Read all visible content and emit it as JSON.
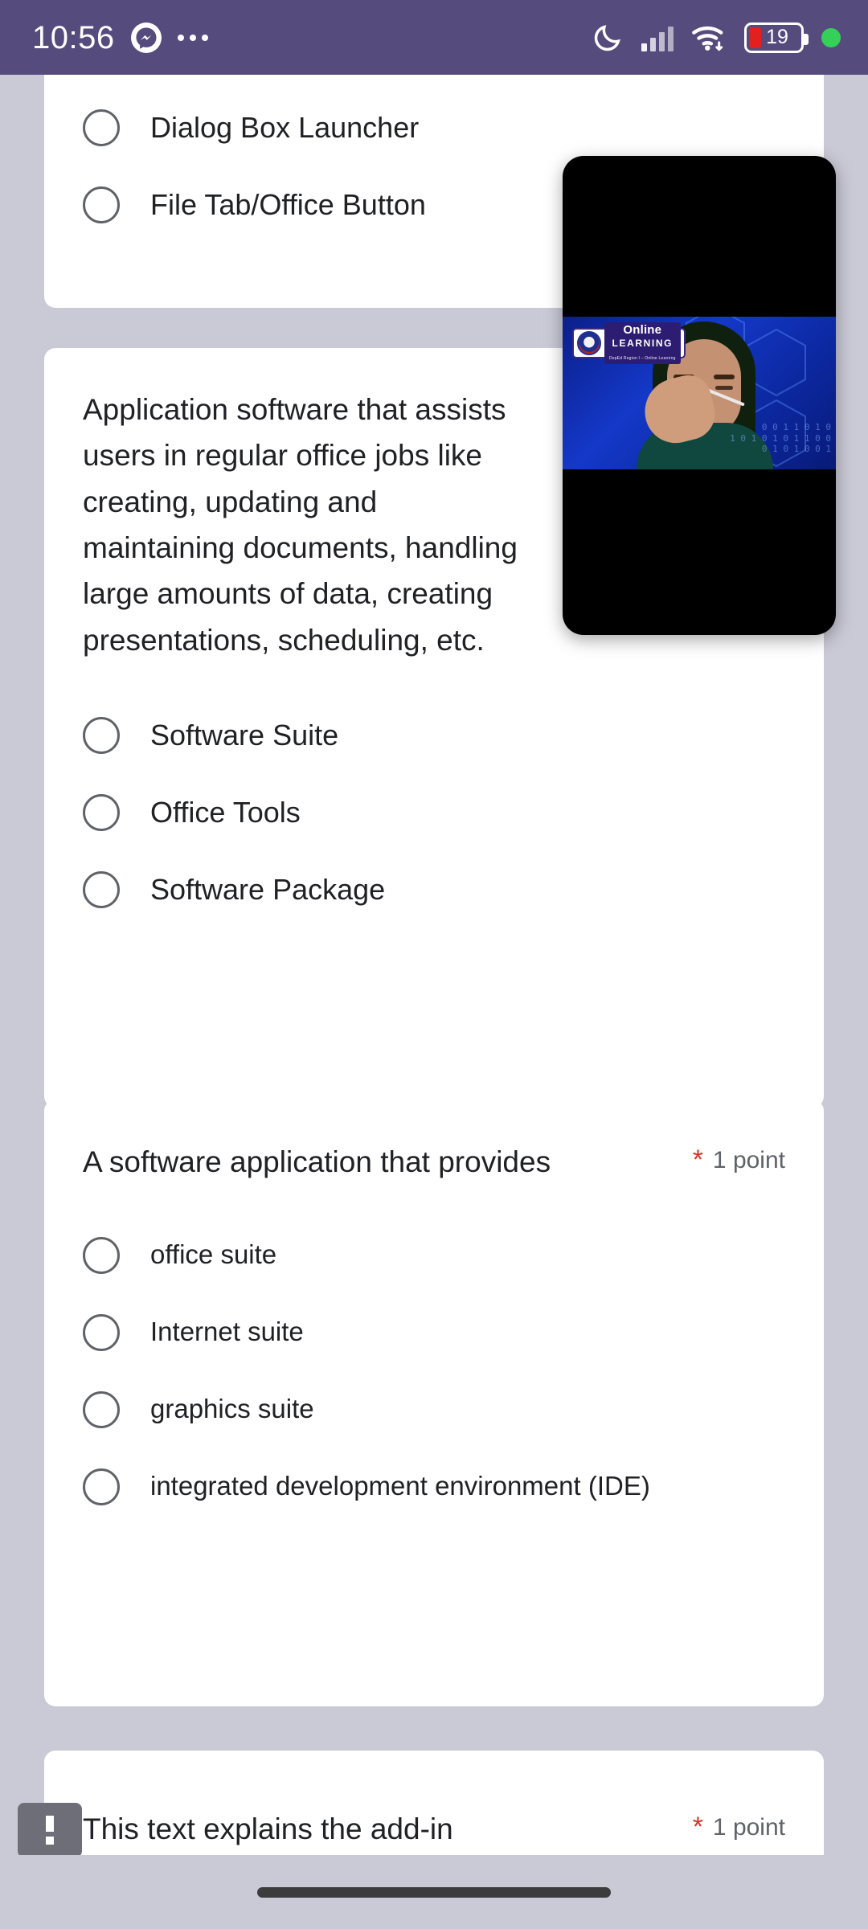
{
  "status_bar": {
    "time": "10:56",
    "messenger_icon": "messenger-icon",
    "overflow_icon": "more-notifications-icon",
    "dnd_icon": "moon-icon",
    "signal_icon": "cellular-signal-icon",
    "wifi_icon": "wifi-icon",
    "battery_level": "19",
    "battery_icon": "battery-icon",
    "recording_dot": "green-status-dot",
    "background_color": "#554c7d"
  },
  "theme": {
    "page_background": "#cac9d6",
    "card_background": "#ffffff",
    "text_primary": "#202124",
    "text_secondary": "#5f6368",
    "required_star_color": "#d93025",
    "battery_low_color": "#e32020",
    "status_dot_color": "#34d058"
  },
  "form": {
    "cards": [
      {
        "id": "question-dialog-box-launcher",
        "question": "",
        "points_label": "",
        "required_marker": "",
        "options": [
          {
            "label": "Dialog Box Launcher"
          },
          {
            "label": "File Tab/Office Button"
          }
        ]
      },
      {
        "id": "question-application-software",
        "question": "Application software that assists users in regular office jobs like creating, updating and maintaining documents, handling large amounts of data, creating presentations, scheduling, etc.",
        "points_label": "",
        "required_marker": "",
        "options": [
          {
            "label": "Software Suite"
          },
          {
            "label": "Office Tools"
          },
          {
            "label": "Software Package"
          }
        ]
      },
      {
        "id": "question-software-application-provides",
        "question": "A software application that provides",
        "points_label": "1 point",
        "required_marker": "*",
        "options": [
          {
            "label": "office suite"
          },
          {
            "label": "Internet suite"
          },
          {
            "label": "graphics suite"
          },
          {
            "label": "integrated development environment (IDE)"
          }
        ]
      },
      {
        "id": "question-add-in-text",
        "question": "This text explains the add-in",
        "points_label": "1 point",
        "required_marker": "*",
        "options": []
      }
    ]
  },
  "pip_video": {
    "name": "picture-in-picture-video",
    "logo_line1": "Online",
    "logo_line2": "LEARNING",
    "logo_line3": "DepEd Region I – Online Learning",
    "binary_text_1": "0 0 1 1 0 1 0",
    "binary_text_2": "1 0 1 0 1 0 1 1 0 0",
    "binary_text_3": "0 1 0 1 0 0 1"
  },
  "callout": {
    "name": "info-callout-bubble",
    "glyph": "!"
  },
  "nav": {
    "home_indicator": "home-indicator"
  }
}
